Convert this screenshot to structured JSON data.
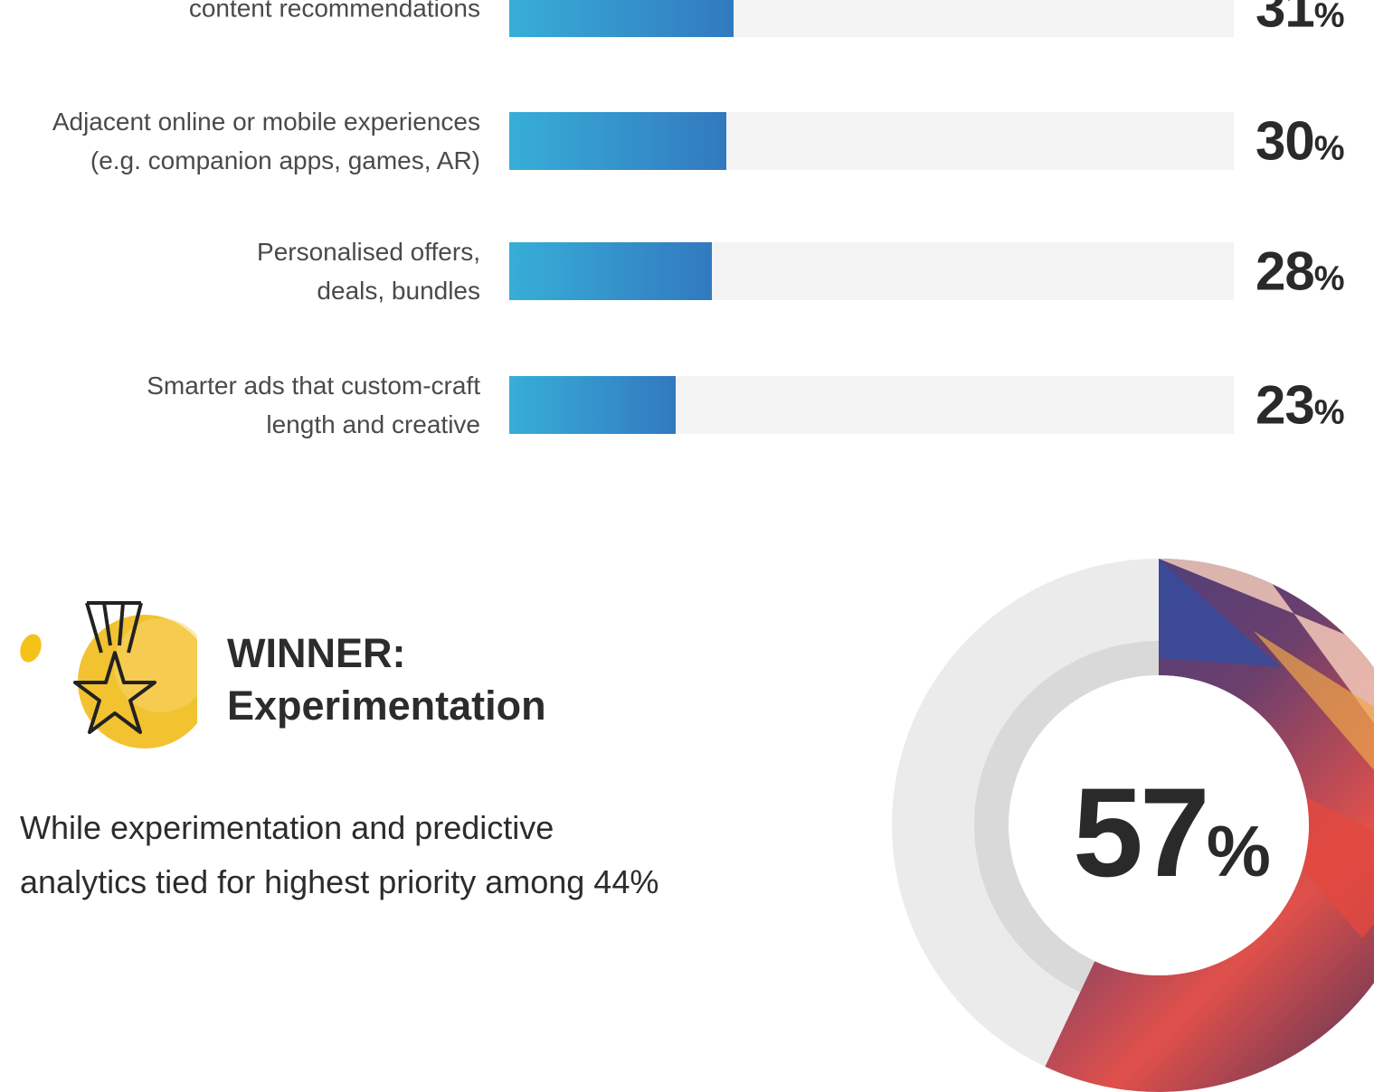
{
  "chart_data": {
    "type": "bar",
    "orientation": "horizontal",
    "max": 100,
    "categories": [
      "content recommendations",
      "Adjacent online or mobile experiences (e.g. companion apps, games, AR)",
      "Personalised offers, deals, bundles",
      "Smarter ads that custom-craft length and creative"
    ],
    "values": [
      31,
      30,
      28,
      23
    ],
    "label_lines": [
      [
        "",
        "content recommendations"
      ],
      [
        "Adjacent online or mobile experiences",
        "(e.g. companion apps, games, AR)"
      ],
      [
        "Personalised offers,",
        "deals, bundles"
      ],
      [
        "Smarter ads that custom-craft",
        "length and creative"
      ]
    ],
    "value_labels": [
      "31",
      "30",
      "28",
      "23"
    ],
    "percent_sign": "%",
    "bar_color_start": "#37aed8",
    "bar_color_end": "#3279bf",
    "track_color": "#f3f3f3"
  },
  "winner": {
    "title": "WINNER:",
    "subtitle": "Experimentation",
    "icon": "medal-star-icon"
  },
  "body": {
    "line1": "While experimentation and predictive",
    "line2": "analytics tied for highest priority among 44%"
  },
  "donut": {
    "value": 57,
    "value_label": "57",
    "percent_sign": "%",
    "ring_color": "#eaeaea",
    "inner_ring_color": "#d7d7d7"
  }
}
